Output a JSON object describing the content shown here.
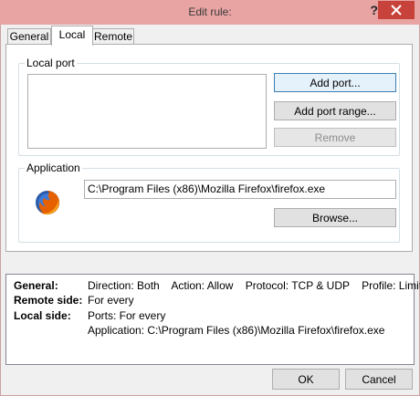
{
  "window": {
    "title": "Edit rule:",
    "help_glyph": "?"
  },
  "tabs": [
    {
      "label": "General",
      "active": false
    },
    {
      "label": "Local",
      "active": true
    },
    {
      "label": "Remote",
      "active": false
    }
  ],
  "local_port": {
    "group_label": "Local port",
    "add_port_label": "Add port...",
    "add_port_range_label": "Add port range...",
    "remove_label": "Remove"
  },
  "application": {
    "group_label": "Application",
    "path_value": "C:\\Program Files (x86)\\Mozilla Firefox\\firefox.exe",
    "browse_label": "Browse...",
    "icon": "firefox-icon"
  },
  "summary": {
    "general_label": "General:",
    "general_value": "Direction: Both    Action: Allow    Protocol: TCP & UDP    Profile: Limited",
    "remote_label": "Remote side:",
    "remote_value": "For every",
    "local_label": "Local side:",
    "local_ports": "Ports: For every",
    "local_app": "Application: C:\\Program Files (x86)\\Mozilla Firefox\\firefox.exe"
  },
  "footer": {
    "ok_label": "OK",
    "cancel_label": "Cancel"
  },
  "colors": {
    "titlebar": "#e8a3a3",
    "close_button": "#c7423a",
    "focus_border": "#3c7fb1"
  }
}
